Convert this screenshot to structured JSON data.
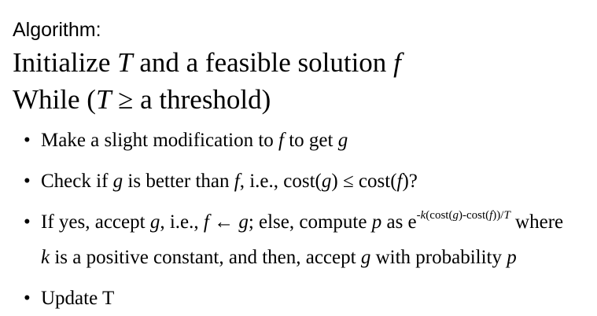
{
  "heading": "Algorithm:",
  "line1": {
    "a": "Initialize ",
    "T": "T",
    "b": " and a feasible solution ",
    "f": "f"
  },
  "line2": {
    "a": "While (",
    "T": "T",
    "b": " ≥ a threshold)"
  },
  "bullets": {
    "glyph": "•",
    "b1": {
      "a": "Make a slight modification to ",
      "f": "f",
      "b": " to get ",
      "g": "g"
    },
    "b2": {
      "a": "Check if ",
      "g": "g",
      "b": " is better than ",
      "f": "f",
      "c": ", i.e., cost(",
      "g2": "g",
      "d": ") ≤ cost(",
      "f2": "f",
      "e": ")?"
    },
    "b3": {
      "a": "If yes, accept ",
      "g": "g",
      "b": ", i.e., ",
      "f": "f",
      "c": " ← ",
      "g2": "g",
      "d": "; else, compute ",
      "p": "p",
      "e": " as e",
      "exp_k": "-k",
      "exp_a": "(cost(",
      "exp_g": "g",
      "exp_b": ")-cost(",
      "exp_f": "f",
      "exp_c": "))/",
      "exp_T": "T",
      "f_": " where",
      "cont_k": "k",
      "cont_a": " is a positive constant, and then, accept ",
      "cont_g": "g",
      "cont_b": " with probability ",
      "cont_p": "p"
    },
    "b4": {
      "a": "Update T"
    }
  }
}
